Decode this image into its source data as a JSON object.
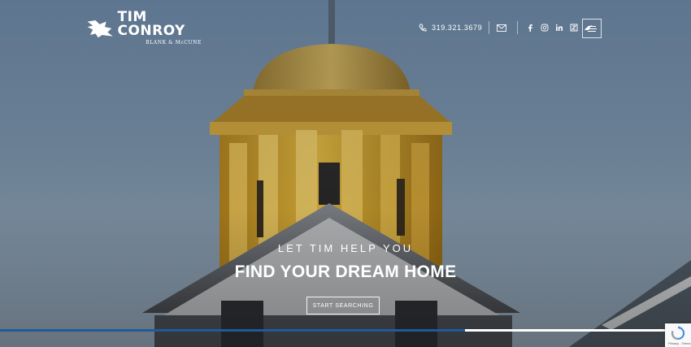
{
  "brand": {
    "name": "TIM CONROY",
    "sub": "BLANK & McCUNE"
  },
  "nav": {
    "phone": "319.321.3679",
    "icons": [
      "phone-icon",
      "mail-icon",
      "facebook-icon",
      "instagram-icon",
      "linkedin-icon",
      "zillow-icon",
      "realtor-icon"
    ]
  },
  "hero": {
    "tagline": "LET TIM HELP YOU",
    "headline": "FIND YOUR DREAM HOME",
    "cta": "START SEARCHING"
  },
  "slider": {
    "progress": 0.697
  },
  "recaptcha": {
    "label": "Privacy - Terms"
  },
  "colors": {
    "accent": "#1f5a9a",
    "gold": "#d9a92e"
  }
}
